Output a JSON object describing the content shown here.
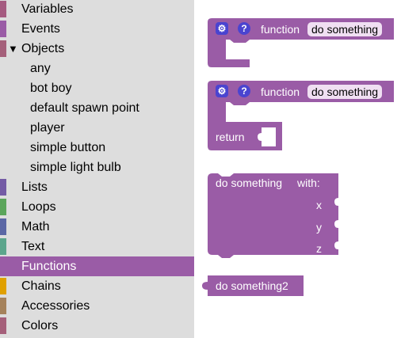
{
  "toolbox": {
    "items": [
      {
        "label": "Variables",
        "color": "#a55b80"
      },
      {
        "label": "Events",
        "color": "#9a5ca6"
      },
      {
        "label": "Objects",
        "color": "#a5607a"
      },
      {
        "label": "any"
      },
      {
        "label": "bot boy"
      },
      {
        "label": "default spawn point"
      },
      {
        "label": "player"
      },
      {
        "label": "simple button"
      },
      {
        "label": "simple light bulb"
      },
      {
        "label": "Lists",
        "color": "#745ba5"
      },
      {
        "label": "Loops",
        "color": "#5ba55b"
      },
      {
        "label": "Math",
        "color": "#5b67a5"
      },
      {
        "label": "Text",
        "color": "#5ba58c"
      },
      {
        "label": "Functions",
        "color": "#9a5ca6"
      },
      {
        "label": "Chains",
        "color": "#e0a000"
      },
      {
        "label": "Accessories",
        "color": "#a5825b"
      },
      {
        "label": "Colors",
        "color": "#a5607a"
      }
    ],
    "expanded_arrow": "▼",
    "selected": "Functions"
  },
  "blocks": {
    "function_block_1": {
      "keyword": "function",
      "name": "do something",
      "gear_icon": "gear-icon",
      "help_icon": "?"
    },
    "function_block_2": {
      "keyword": "function",
      "name": "do something",
      "gear_icon": "gear-icon",
      "help_icon": "?",
      "return_label": "return"
    },
    "call_with_block": {
      "label": "do something",
      "with_label": "with:",
      "params": [
        "x",
        "y",
        "z"
      ]
    },
    "call_block": {
      "label": "do something2"
    },
    "color": "#9a5ca6"
  }
}
